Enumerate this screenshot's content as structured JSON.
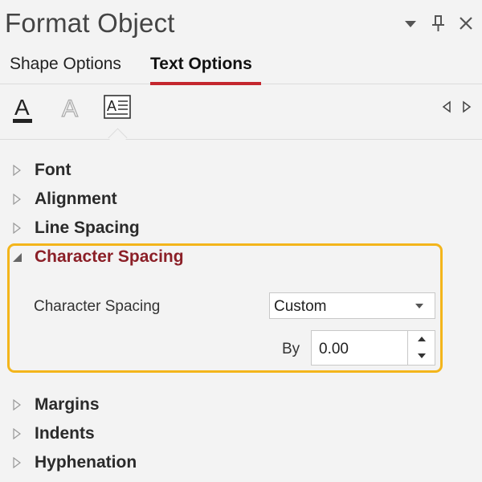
{
  "window": {
    "title": "Format Object",
    "dropdown_icon": "chevron-down-icon",
    "pin_icon": "pin-icon",
    "close_icon": "close-icon"
  },
  "tabs": [
    {
      "label": "Shape Options",
      "active": false
    },
    {
      "label": "Text Options",
      "active": true
    }
  ],
  "icon_tabs": [
    {
      "name": "text-fill-outline-icon",
      "active": false
    },
    {
      "name": "text-effects-icon",
      "active": false
    },
    {
      "name": "textbox-icon",
      "active": true
    }
  ],
  "sections": [
    {
      "label": "Font",
      "expanded": false
    },
    {
      "label": "Alignment",
      "expanded": false
    },
    {
      "label": "Line Spacing",
      "expanded": false
    },
    {
      "label": "Character Spacing",
      "expanded": true
    },
    {
      "label": "Margins",
      "expanded": false
    },
    {
      "label": "Indents",
      "expanded": false
    },
    {
      "label": "Hyphenation",
      "expanded": false
    }
  ],
  "character_spacing": {
    "spacing_label": "Character Spacing",
    "spacing_value": "Custom",
    "by_label": "By",
    "by_value": "0.00"
  },
  "colors": {
    "accent_red": "#c4262e",
    "expanded_section": "#8b1f27",
    "highlight": "#f3b51b",
    "background": "#f3f3f3"
  }
}
